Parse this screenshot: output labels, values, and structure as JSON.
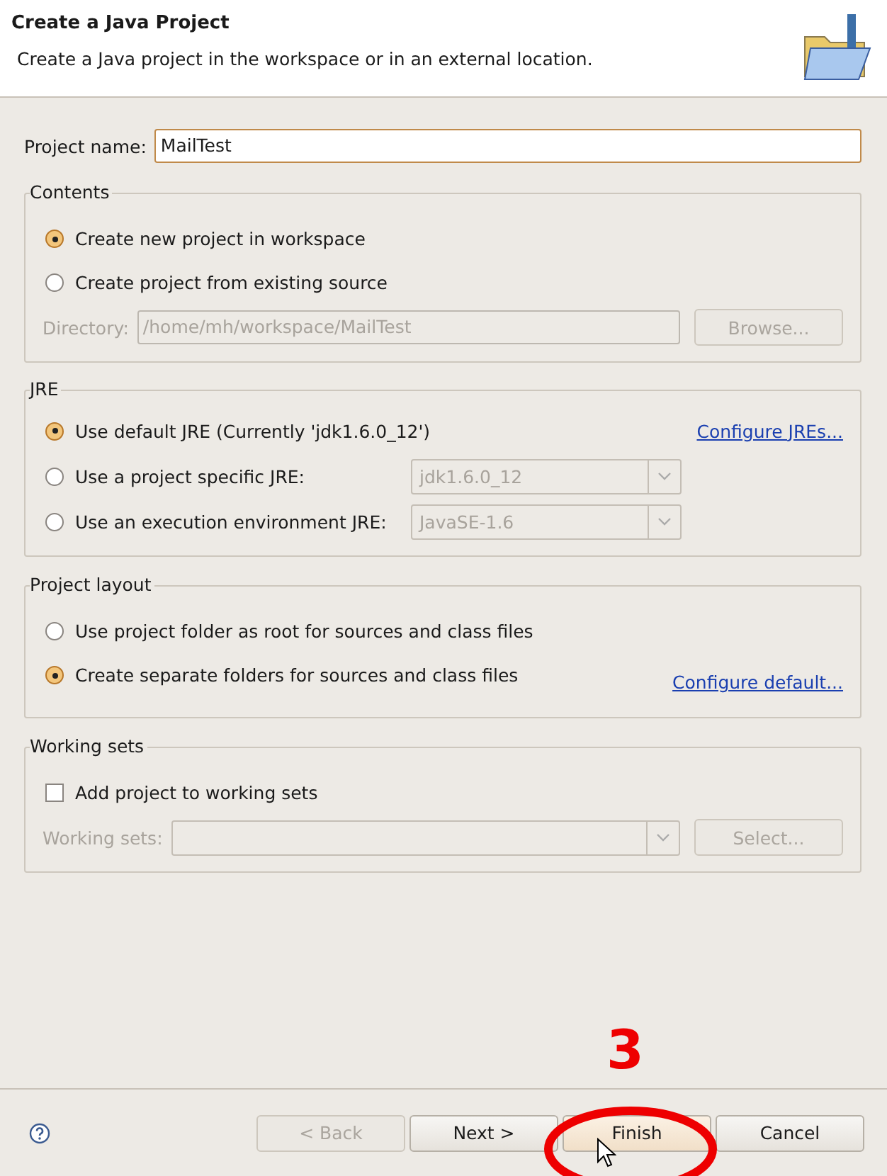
{
  "header": {
    "title": "Create a Java Project",
    "description": "Create a Java project in the workspace or in an external location."
  },
  "project_name": {
    "label": "Project name:",
    "value": "MailTest"
  },
  "contents": {
    "title": "Contents",
    "options": [
      {
        "label": "Create new project in workspace",
        "selected": true
      },
      {
        "label": "Create project from existing source",
        "selected": false
      }
    ],
    "directory": {
      "label": "Directory:",
      "value": "/home/mh/workspace/MailTest",
      "disabled": true
    },
    "browse_button": {
      "label": "Browse...",
      "disabled": true
    }
  },
  "jre": {
    "title": "JRE",
    "options": [
      {
        "label": "Use default JRE (Currently 'jdk1.6.0_12')",
        "selected": true,
        "kind": "link",
        "link": "Configure JREs..."
      },
      {
        "label": "Use a project specific JRE:",
        "selected": false,
        "kind": "combo",
        "value": "jdk1.6.0_12",
        "disabled": true
      },
      {
        "label": "Use an execution environment JRE:",
        "selected": false,
        "kind": "combo",
        "value": "JavaSE-1.6",
        "disabled": true
      }
    ]
  },
  "layout": {
    "title": "Project layout",
    "options": [
      {
        "label": "Use project folder as root for sources and class files",
        "selected": false
      },
      {
        "label": "Create separate folders for sources and class files",
        "selected": true
      }
    ],
    "link": "Configure default..."
  },
  "working_sets": {
    "title": "Working sets",
    "checkbox": {
      "label": "Add project to working sets",
      "checked": false
    },
    "field": {
      "label": "Working sets:",
      "disabled": true
    },
    "select_button": {
      "label": "Select...",
      "disabled": true
    }
  },
  "buttons": [
    {
      "label": "< Back",
      "disabled": true,
      "focused": false
    },
    {
      "label": "Next >",
      "disabled": false,
      "focused": false
    },
    {
      "label": "Finish",
      "disabled": false,
      "focused": true
    },
    {
      "label": "Cancel",
      "disabled": false,
      "focused": false
    }
  ],
  "annotation": {
    "step": "3"
  }
}
